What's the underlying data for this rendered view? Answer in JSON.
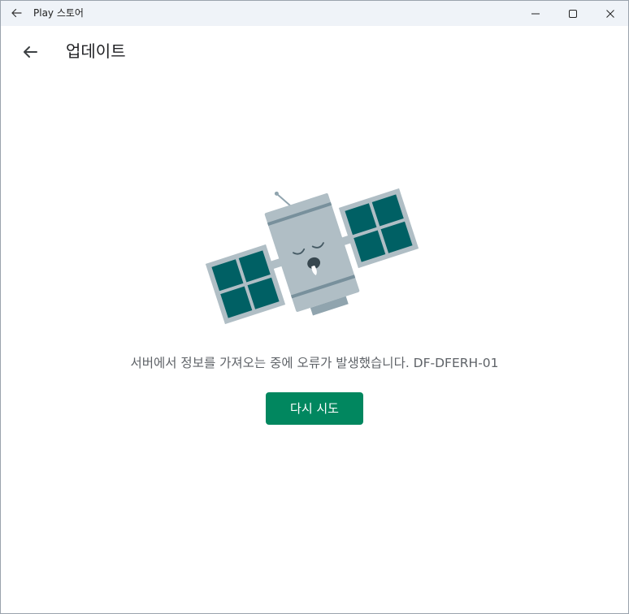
{
  "titlebar": {
    "app_title": "Play 스토어",
    "back_icon": "arrow-left-icon",
    "minimize_icon": "minimize-icon",
    "maximize_icon": "maximize-icon",
    "close_icon": "close-icon"
  },
  "header": {
    "back_icon": "arrow-left-icon",
    "title": "업데이트"
  },
  "main": {
    "illustration": "broken-satellite-illustration",
    "error_message": "서버에서 정보를 가져오는 중에 오류가 발생했습니다. DF-DFERH-01",
    "retry_label": "다시 시도"
  },
  "colors": {
    "accent": "#01875f",
    "satellite_panel": "#006064",
    "satellite_body": "#b0bec5",
    "satellite_trim": "#78909c"
  }
}
